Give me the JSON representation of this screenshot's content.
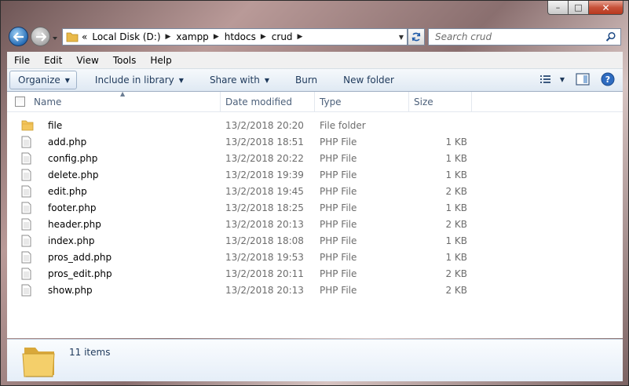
{
  "window": {
    "caption": {
      "minimize": "–",
      "maximize": "□",
      "close": "✕"
    }
  },
  "nav": {
    "overflow": "«",
    "breadcrumb": [
      "Local Disk (D:)",
      "xampp",
      "htdocs",
      "crud"
    ],
    "search_placeholder": "Search crud"
  },
  "menu": [
    "File",
    "Edit",
    "View",
    "Tools",
    "Help"
  ],
  "commands": {
    "organize": "Organize",
    "include": "Include in library",
    "share": "Share with",
    "burn": "Burn",
    "new_folder": "New folder"
  },
  "columns": {
    "name": "Name",
    "date": "Date modified",
    "type": "Type",
    "size": "Size"
  },
  "files": [
    {
      "name": "file",
      "date": "13/2/2018 20:20",
      "type": "File folder",
      "size": "",
      "icon": "folder-icon"
    },
    {
      "name": "add.php",
      "date": "13/2/2018 18:51",
      "type": "PHP File",
      "size": "1 KB",
      "icon": "file-icon"
    },
    {
      "name": "config.php",
      "date": "13/2/2018 20:22",
      "type": "PHP File",
      "size": "1 KB",
      "icon": "file-icon"
    },
    {
      "name": "delete.php",
      "date": "13/2/2018 19:39",
      "type": "PHP File",
      "size": "1 KB",
      "icon": "file-icon"
    },
    {
      "name": "edit.php",
      "date": "13/2/2018 19:45",
      "type": "PHP File",
      "size": "2 KB",
      "icon": "file-icon"
    },
    {
      "name": "footer.php",
      "date": "13/2/2018 18:25",
      "type": "PHP File",
      "size": "1 KB",
      "icon": "file-icon"
    },
    {
      "name": "header.php",
      "date": "13/2/2018 20:13",
      "type": "PHP File",
      "size": "2 KB",
      "icon": "file-icon"
    },
    {
      "name": "index.php",
      "date": "13/2/2018 18:08",
      "type": "PHP File",
      "size": "1 KB",
      "icon": "file-icon"
    },
    {
      "name": "pros_add.php",
      "date": "13/2/2018 19:53",
      "type": "PHP File",
      "size": "1 KB",
      "icon": "file-icon"
    },
    {
      "name": "pros_edit.php",
      "date": "13/2/2018 20:11",
      "type": "PHP File",
      "size": "2 KB",
      "icon": "file-icon"
    },
    {
      "name": "show.php",
      "date": "13/2/2018 20:13",
      "type": "PHP File",
      "size": "2 KB",
      "icon": "file-icon"
    }
  ],
  "details": {
    "count": "11 items"
  },
  "colors": {
    "accent": "#1e395b",
    "folder": "#f2c55c"
  }
}
